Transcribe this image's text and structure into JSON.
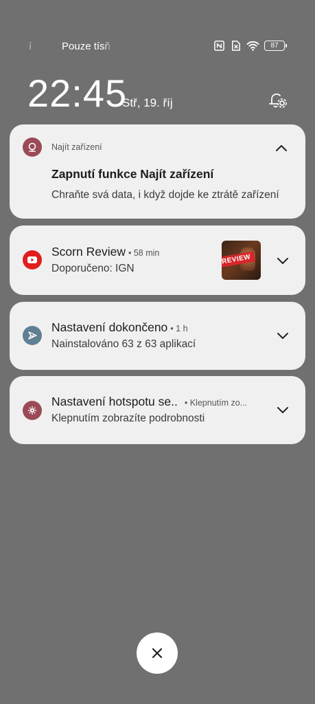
{
  "status_bar": {
    "faded_char": "í",
    "carrier": "Pouze tísň",
    "battery_level": "87",
    "icons": [
      "nfc-icon",
      "no-sim-icon",
      "wifi-icon",
      "battery-icon"
    ]
  },
  "lockscreen": {
    "time": "22:45",
    "date": "Stř, 19. říj"
  },
  "notifications": [
    {
      "app": "Najít zařízení",
      "icon": "find-device-icon",
      "icon_color": "#9a4b57",
      "title": "Zapnutí funkce Najít zařízení",
      "body": "Chraňte svá data, i když dojde ke ztrátě zařízení"
    },
    {
      "icon": "youtube-icon",
      "icon_color": "#e01e1e",
      "title": "Scorn Review",
      "meta": "• 58 min",
      "body": "Doporučeno: IGN",
      "thumbnail_text": "REVIEW"
    },
    {
      "icon": "setup-icon",
      "icon_color": "#5f7f93",
      "title": "Nastavení dokončeno",
      "meta": "• 1 h",
      "body": "Nainstalováno 63 z 63 aplikací"
    },
    {
      "icon": "hotspot-icon",
      "icon_color": "#9a4b57",
      "title": "Nastavení hotspotu se..",
      "meta": "• Klepnutím zo...",
      "body": "Klepnutím zobrazíte podrobnosti"
    }
  ],
  "colors": {
    "background": "#707070",
    "card": "#f1f0f0",
    "text_primary": "#1c1c1c"
  }
}
